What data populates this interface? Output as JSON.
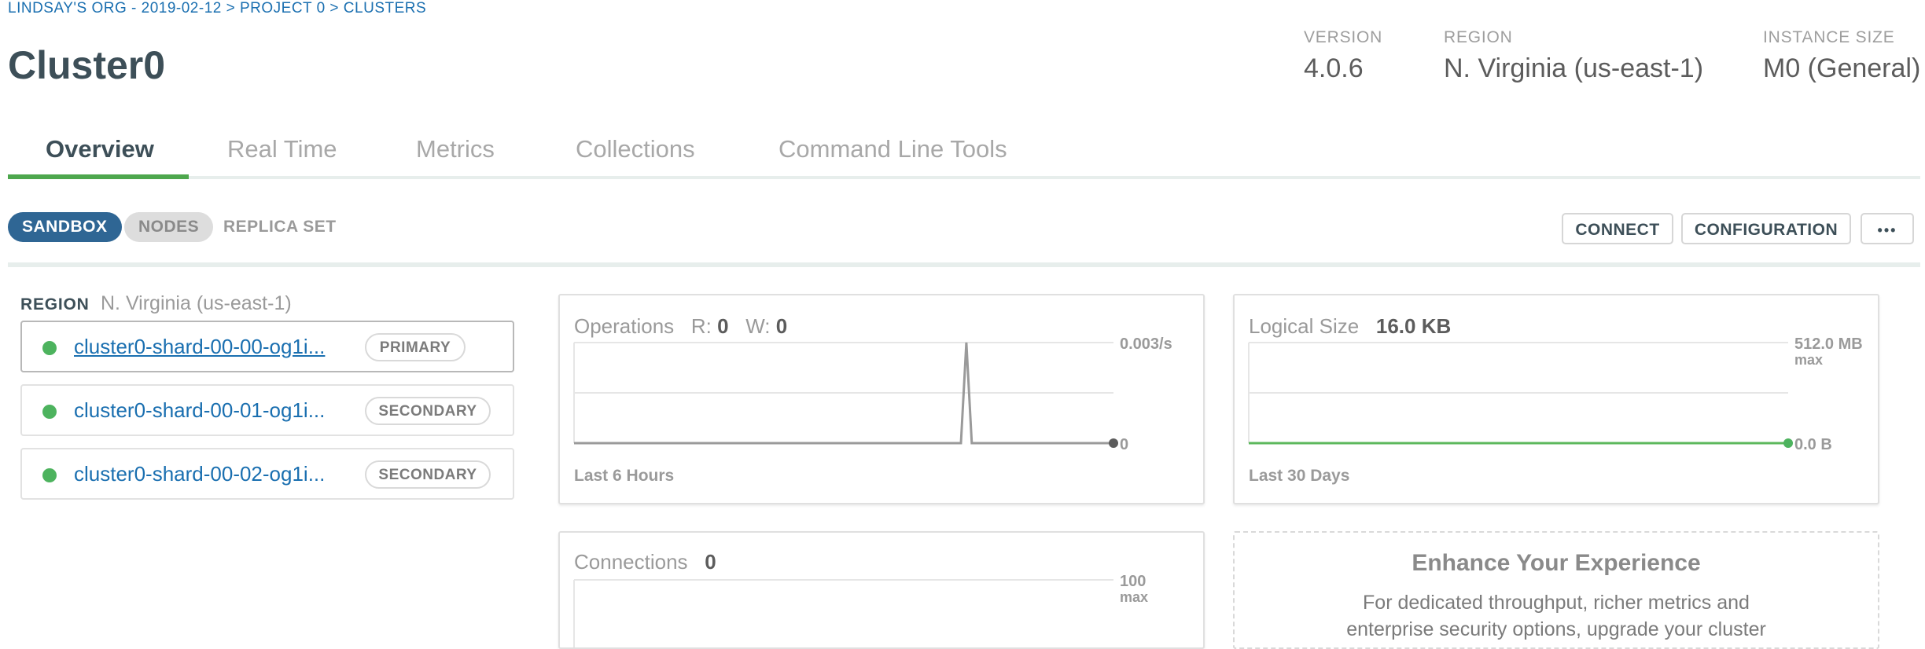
{
  "breadcrumb": "LINDSAY'S ORG - 2019-02-12 > PROJECT 0 > CLUSTERS",
  "cluster_name": "Cluster0",
  "meta": {
    "version_label": "VERSION",
    "version": "4.0.6",
    "region_label": "REGION",
    "region": "N. Virginia (us-east-1)",
    "size_label": "INSTANCE SIZE",
    "size": "M0 (General)"
  },
  "tabs": [
    "Overview",
    "Real Time",
    "Metrics",
    "Collections",
    "Command Line Tools"
  ],
  "active_tab": "Overview",
  "pills": {
    "sandbox": "SANDBOX",
    "nodes": "NODES",
    "replica": "REPLICA SET"
  },
  "actions": {
    "connect": "CONNECT",
    "configuration": "CONFIGURATION",
    "more": "•••"
  },
  "region_panel": {
    "label": "REGION",
    "value": "N. Virginia (us-east-1)",
    "nodes": [
      {
        "host": "cluster0-shard-00-00-og1i...",
        "role": "PRIMARY"
      },
      {
        "host": "cluster0-shard-00-01-og1i...",
        "role": "SECONDARY"
      },
      {
        "host": "cluster0-shard-00-02-og1i...",
        "role": "SECONDARY"
      }
    ]
  },
  "operations_card": {
    "title": "Operations",
    "r_label": "R:",
    "r_value": "0",
    "w_label": "W:",
    "w_value": "0",
    "max_label": "0.003/s",
    "zero_label": "0",
    "footer": "Last 6 Hours"
  },
  "logical_size_card": {
    "title": "Logical Size",
    "value": "16.0 KB",
    "max_label": "512.0 MB",
    "max_sub": "max",
    "zero_label": "0.0 B",
    "footer": "Last 30 Days"
  },
  "connections_card": {
    "title": "Connections",
    "value": "0",
    "max_label": "100",
    "max_sub": "max"
  },
  "promo": {
    "title": "Enhance Your Experience",
    "text_line1": "For dedicated throughput, richer metrics and",
    "text_line2": "enterprise security options, upgrade your cluster"
  },
  "colors": {
    "link": "#1a6fb0",
    "sandbox_pill": "#2f6694",
    "active_tab_underline": "#4da74d",
    "node_status": "#4db35e",
    "size_line": "#5cb85c"
  },
  "chart_data": [
    {
      "type": "line",
      "title": "Operations",
      "ylim": [
        0,
        0.003
      ],
      "xlabel": "Last 6 Hours",
      "series": [
        {
          "values": [
            0,
            0,
            0,
            0,
            0,
            0,
            0,
            0,
            0,
            0,
            0,
            0,
            0,
            0,
            0,
            0,
            0,
            0,
            0,
            0,
            0,
            0,
            0,
            0,
            0,
            0,
            0,
            0,
            0,
            0,
            0,
            0,
            0,
            0,
            0,
            0,
            0,
            0,
            0,
            0,
            0,
            0,
            0,
            0,
            0,
            0,
            0,
            0,
            0,
            0,
            0,
            0,
            0,
            0,
            0,
            0,
            0,
            0,
            0,
            0,
            0,
            0,
            0,
            0,
            0,
            0,
            0,
            0,
            0,
            0,
            0,
            0,
            0.003,
            0,
            0,
            0,
            0,
            0,
            0,
            0,
            0,
            0,
            0,
            0,
            0,
            0,
            0,
            0,
            0,
            0,
            0,
            0,
            0,
            0,
            0,
            0,
            0,
            0,
            0,
            0
          ]
        }
      ]
    },
    {
      "type": "line",
      "title": "Logical Size",
      "ylim": [
        0,
        512
      ],
      "xlabel": "Last 30 Days",
      "series": [
        {
          "values": [
            0.016,
            0.016
          ]
        }
      ]
    }
  ]
}
